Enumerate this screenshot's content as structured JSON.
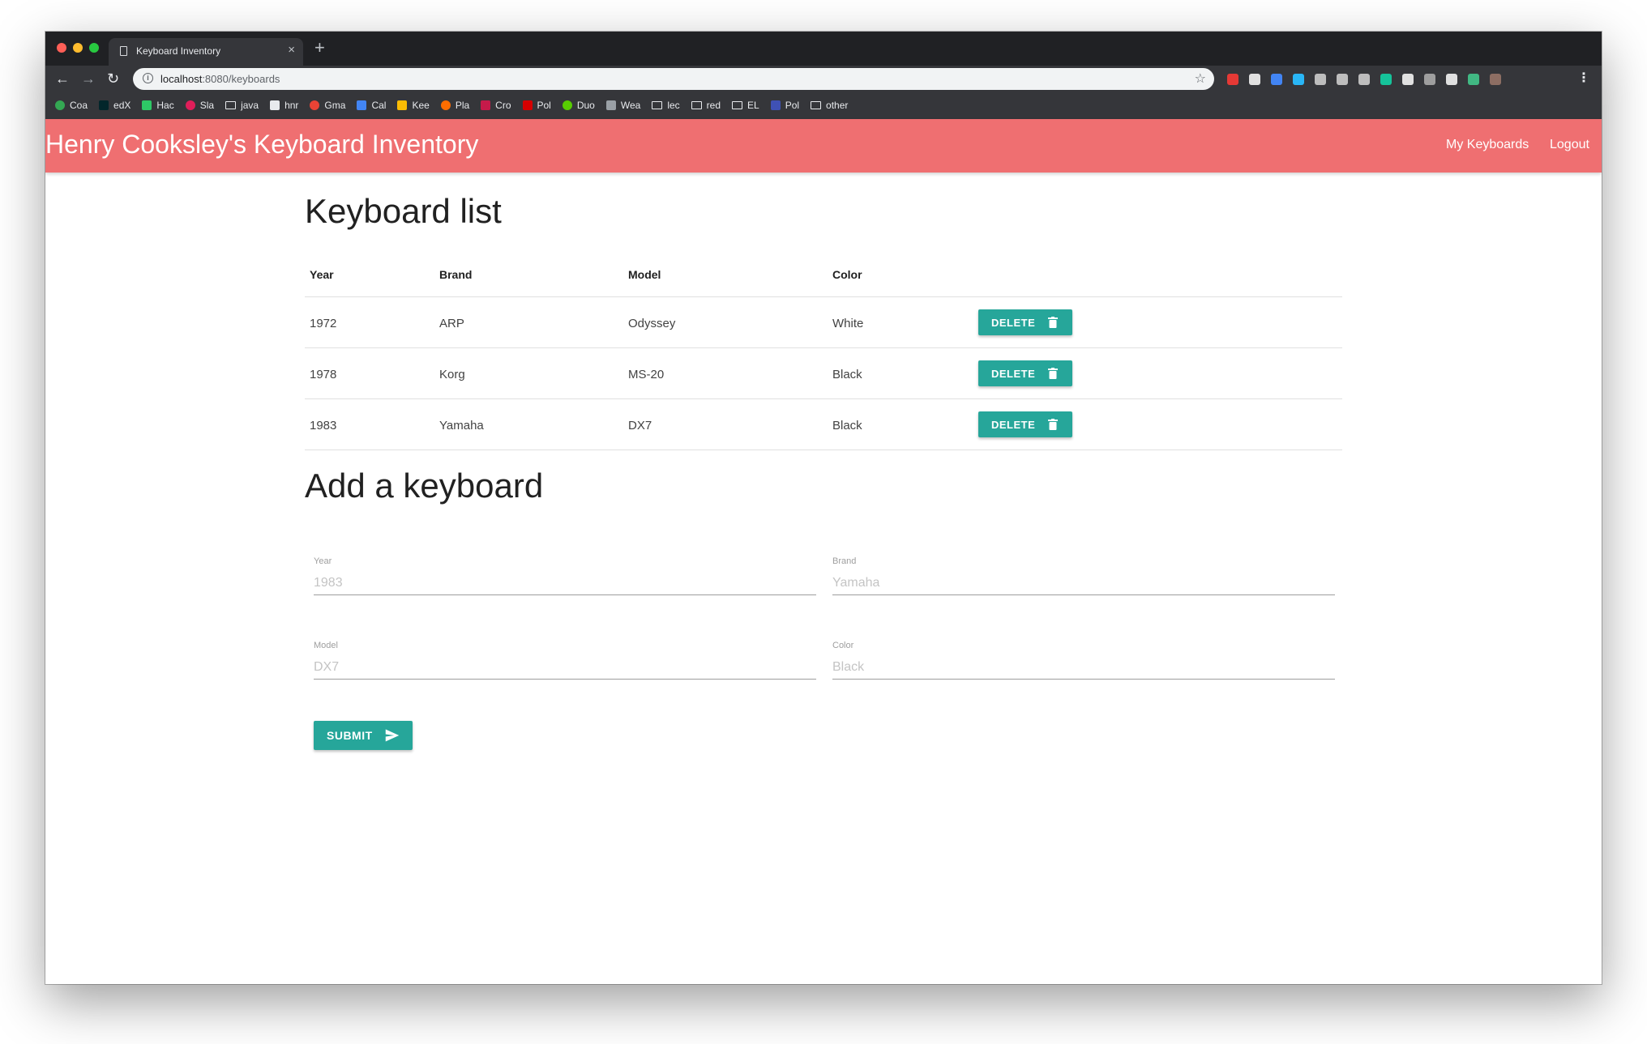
{
  "browser": {
    "tab_title": "Keyboard Inventory",
    "tab_close": "×",
    "new_tab": "+",
    "url_host": "localhost",
    "url_rest": ":8080/keyboards",
    "bookmarks": [
      {
        "label": "Coa",
        "icon": "sheets-icon",
        "color": "#34a853"
      },
      {
        "label": "edX",
        "icon": "edx-icon",
        "color": "#02262b"
      },
      {
        "label": "Hac",
        "icon": "hackerrank-icon",
        "color": "#2ec866"
      },
      {
        "label": "Sla",
        "icon": "slack-icon",
        "color": "#e01e5a"
      },
      {
        "label": "java",
        "icon": "folder-icon",
        "color": "folder"
      },
      {
        "label": "hnr",
        "icon": "github-icon",
        "color": "#e8eaed"
      },
      {
        "label": "Gma",
        "icon": "gmail-icon",
        "color": "#ea4335"
      },
      {
        "label": "Cal",
        "icon": "calendar-icon",
        "color": "#4285f4"
      },
      {
        "label": "Kee",
        "icon": "keep-icon",
        "color": "#fbbc04"
      },
      {
        "label": "Pla",
        "icon": "playlist-icon",
        "color": "#ff6d00"
      },
      {
        "label": "Cro",
        "icon": "raspberry-icon",
        "color": "#c51a4a"
      },
      {
        "label": "Pol",
        "icon": "politico-icon",
        "color": "#d50000"
      },
      {
        "label": "Duo",
        "icon": "duolingo-icon",
        "color": "#58cc02"
      },
      {
        "label": "Wea",
        "icon": "weather-icon",
        "color": "#9aa0a6"
      },
      {
        "label": "lec",
        "icon": "folder-icon",
        "color": "folder"
      },
      {
        "label": "red",
        "icon": "folder-icon",
        "color": "folder"
      },
      {
        "label": "EL",
        "icon": "folder-icon",
        "color": "folder"
      },
      {
        "label": "Pol",
        "icon": "calendar-grid-icon",
        "color": "#3f51b5"
      },
      {
        "label": "other",
        "icon": "folder-icon",
        "color": "folder"
      }
    ],
    "extensions": [
      "#e53935",
      "#e0e0e0",
      "#4285f4",
      "#29b6f6",
      "#bdbdbd",
      "#bdbdbd",
      "#bdbdbd",
      "#15c39a",
      "#e0e0e0",
      "#9e9e9e",
      "#e0e0e0",
      "#41b883",
      "#8d6e63"
    ]
  },
  "app": {
    "title": "Henry Cooksley's Keyboard Inventory",
    "nav": {
      "my_keyboards": "My Keyboards",
      "logout": "Logout"
    },
    "accent_color": "#ef6f71",
    "button_color": "#26a69a"
  },
  "list": {
    "heading": "Keyboard list",
    "columns": {
      "year": "Year",
      "brand": "Brand",
      "model": "Model",
      "color": "Color"
    },
    "delete_label": "DELETE",
    "rows": [
      {
        "year": "1972",
        "brand": "ARP",
        "model": "Odyssey",
        "color": "White"
      },
      {
        "year": "1978",
        "brand": "Korg",
        "model": "MS-20",
        "color": "Black"
      },
      {
        "year": "1983",
        "brand": "Yamaha",
        "model": "DX7",
        "color": "Black"
      }
    ]
  },
  "form": {
    "heading": "Add a keyboard",
    "year": {
      "label": "Year",
      "placeholder": "1983"
    },
    "brand": {
      "label": "Brand",
      "placeholder": "Yamaha"
    },
    "model": {
      "label": "Model",
      "placeholder": "DX7"
    },
    "color": {
      "label": "Color",
      "placeholder": "Black"
    },
    "submit_label": "SUBMIT"
  }
}
